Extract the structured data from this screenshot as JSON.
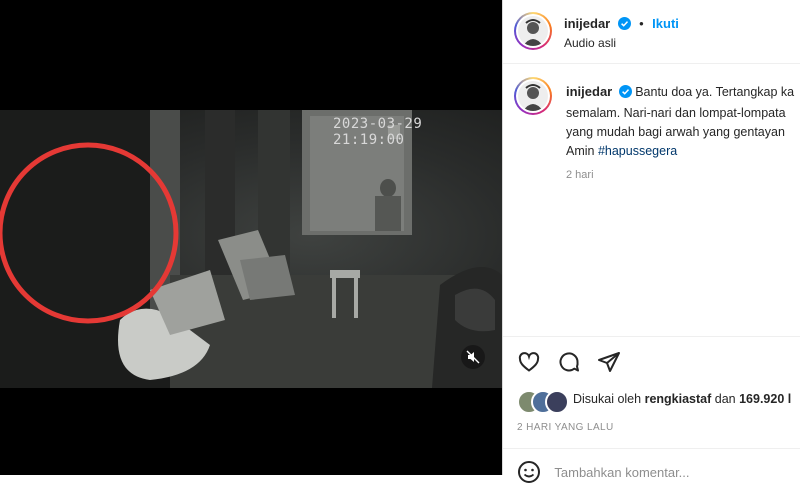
{
  "video": {
    "timestamp": "2023-03-29   21:19:00",
    "mute_icon": "speaker-muted-icon",
    "highlight_color": "#e53935"
  },
  "header": {
    "username": "inijedar",
    "dot": "•",
    "follow_label": "Ikuti",
    "audio_label": "Audio asli"
  },
  "caption": {
    "username": "inijedar",
    "line1": "Bantu doa ya. Tertangkap ka",
    "line2": "semalam. Nari-nari dan lompat-lompata",
    "line3": "yang mudah bagi arwah yang gentayan",
    "line4_prefix": "Amin ",
    "hashtag": "#hapussegera",
    "time_ago": "2 hari"
  },
  "actions": {
    "like_icon": "heart-icon",
    "comment_icon": "comment-icon",
    "share_icon": "send-icon"
  },
  "likes": {
    "prefix": "Disukai oleh ",
    "user": "rengkiastaf",
    "middle": " dan ",
    "count": "169.920 l"
  },
  "post_date": "2 HARI YANG LALU",
  "comment": {
    "placeholder": "Tambahkan komentar..."
  },
  "colors": {
    "accent": "#0095f6",
    "verified": "#0095f6",
    "hashtag": "#00376b"
  }
}
